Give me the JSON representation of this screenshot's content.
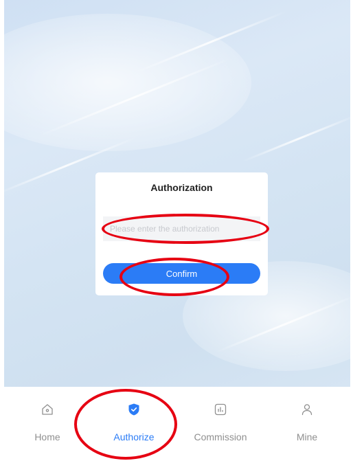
{
  "dialog": {
    "title": "Authorization",
    "input_placeholder": "Please enter the authorization",
    "confirm_label": "Confirm"
  },
  "tabbar": {
    "active": "Authorize",
    "tabs": [
      {
        "label": "Home",
        "icon": "home-icon"
      },
      {
        "label": "Authorize",
        "icon": "shield-check-icon"
      },
      {
        "label": "Commission",
        "icon": "chart-icon"
      },
      {
        "label": "Mine",
        "icon": "user-icon"
      }
    ]
  },
  "colors": {
    "accent": "#2b7cf6",
    "annotation": "#e60012",
    "inactive_tab": "#8f8f8f"
  }
}
